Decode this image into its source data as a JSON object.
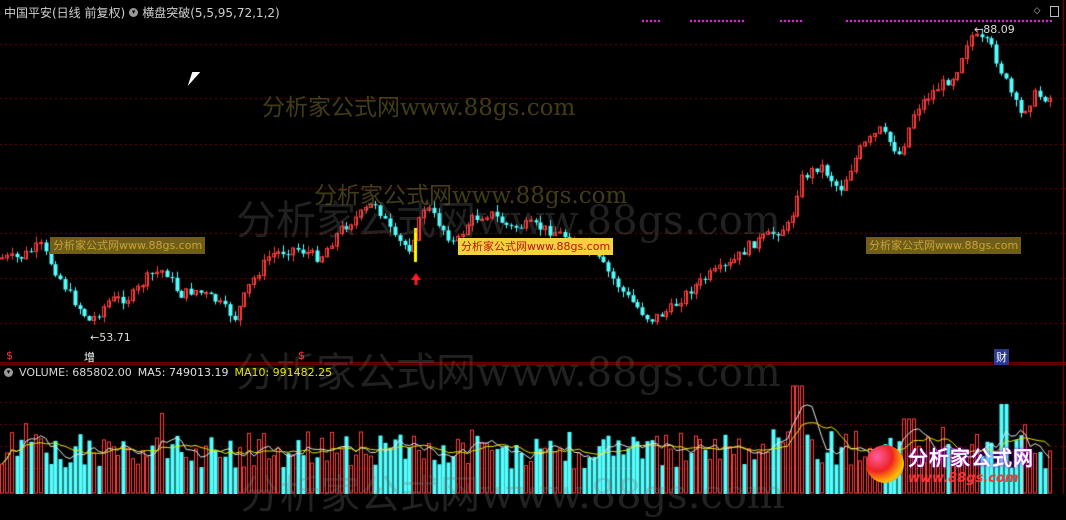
{
  "header": {
    "symbol_label": "中国平安(日线 前复权)",
    "indicator_label": "横盘突破(5,5,95,72,1,2)"
  },
  "volume_panel": {
    "volume_label": "VOLUME: 685802.00",
    "ma5_label": "MA5: 749013.19",
    "ma10_label": "MA10: 991482.25"
  },
  "watermark": {
    "text": "分析家公式网www.88gs.com",
    "tag_text": "分析家公式网www.88gs.com"
  },
  "markers": {
    "high_label": "88.09",
    "low_label": "53.71",
    "increase_flag": "增",
    "dollar_flag": "$",
    "finance_flag": "财"
  },
  "logo": {
    "title": "分析家公式网",
    "url": "www.88gs.com"
  },
  "colors": {
    "up": "#ff3c3c",
    "down": "#54ffff",
    "grid": "#7a0000",
    "ma_white": "#e8e8e8",
    "ma_yellow": "#e8e800",
    "signal_magenta": "#ff40ff",
    "signal_yellow": "#ffff00"
  },
  "icons": [
    "circle-chevron-icon",
    "diamond-nav-icon",
    "panel-toggle-icon",
    "signal-up-arrow-icon"
  ],
  "chart_data": {
    "type": "candlestick",
    "title": "",
    "price_range": [
      53.71,
      88.09
    ],
    "high": 88.09,
    "low": 53.71,
    "volume_series": {
      "name": "VOLUME",
      "last": 685802.0
    },
    "ma_series": [
      {
        "name": "MA5",
        "last": 749013.19
      },
      {
        "name": "MA10",
        "last": 991482.25
      }
    ]
  }
}
